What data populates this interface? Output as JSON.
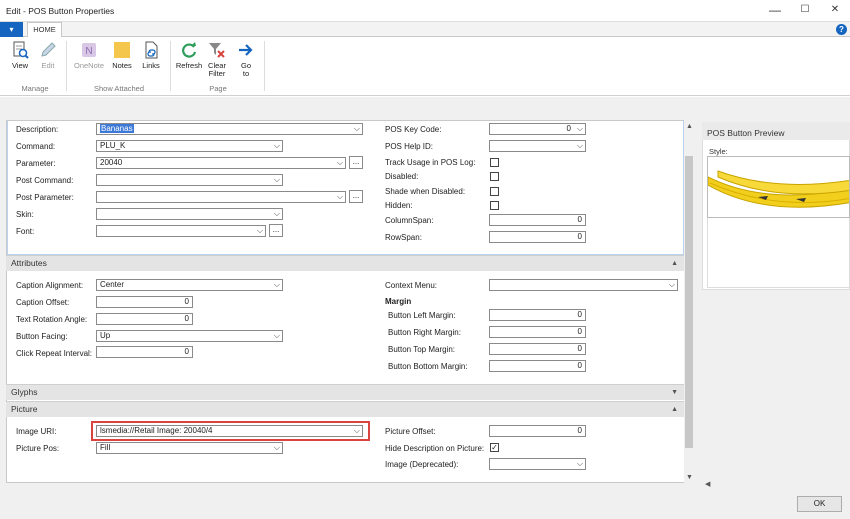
{
  "window": {
    "title": "Edit - POS Button Properties",
    "minimize": "—",
    "maximize": "☐",
    "close": "✕"
  },
  "ribbon": {
    "tab": "HOME",
    "app_menu": "▾",
    "help": "?",
    "buttons": {
      "view": "View",
      "edit": "Edit",
      "onenote": "OneNote",
      "notes": "Notes",
      "links": "Links",
      "refresh": "Refresh",
      "clear_filter_1": "Clear",
      "clear_filter_2": "Filter",
      "goto_1": "Go",
      "goto_2": "to"
    },
    "groups": {
      "manage": "Manage",
      "show_attached": "Show Attached",
      "page": "Page"
    }
  },
  "general": {
    "description_label": "Description:",
    "description_value": "Bananas",
    "command_label": "Command:",
    "command_value": "PLU_K",
    "parameter_label": "Parameter:",
    "parameter_value": "20040",
    "post_command_label": "Post Command:",
    "post_command_value": "",
    "post_parameter_label": "Post Parameter:",
    "post_parameter_value": "",
    "skin_label": "Skin:",
    "skin_value": "",
    "font_label": "Font:",
    "font_value": "",
    "pos_key_code_label": "POS Key Code:",
    "pos_key_code_value": "0",
    "pos_help_id_label": "POS Help ID:",
    "pos_help_id_value": "",
    "track_usage_label": "Track Usage in POS Log:",
    "disabled_label": "Disabled:",
    "shade_label": "Shade when Disabled:",
    "hidden_label": "Hidden:",
    "columnspan_label": "ColumnSpan:",
    "columnspan_value": "0",
    "rowspan_label": "RowSpan:",
    "rowspan_value": "0",
    "ellipsis": "..."
  },
  "attributes": {
    "header": "Attributes",
    "caption_alignment_label": "Caption Alignment:",
    "caption_alignment_value": "Center",
    "caption_offset_label": "Caption Offset:",
    "caption_offset_value": "0",
    "text_rotation_label": "Text Rotation Angle:",
    "text_rotation_value": "0",
    "button_facing_label": "Button Facing:",
    "button_facing_value": "Up",
    "click_repeat_label": "Click Repeat Interval:",
    "click_repeat_value": "0",
    "context_menu_label": "Context Menu:",
    "context_menu_value": "",
    "margin_header": "Margin",
    "left_margin_label": "Button Left Margin:",
    "left_margin_value": "0",
    "right_margin_label": "Button Right Margin:",
    "right_margin_value": "0",
    "top_margin_label": "Button Top Margin:",
    "top_margin_value": "0",
    "bottom_margin_label": "Button Bottom Margin:",
    "bottom_margin_value": "0"
  },
  "glyphs": {
    "header": "Glyphs"
  },
  "picture": {
    "header": "Picture",
    "image_uri_label": "Image URI:",
    "image_uri_value": "lsmedia://Retail Image: 20040/4",
    "picture_pos_label": "Picture Pos:",
    "picture_pos_value": "Fill",
    "picture_offset_label": "Picture Offset:",
    "picture_offset_value": "0",
    "hide_desc_label": "Hide Description on Picture:",
    "image_deprecated_label": "Image (Deprecated):",
    "image_deprecated_value": ""
  },
  "preview": {
    "title": "POS Button Preview",
    "style_label": "Style:"
  },
  "ok_button": "OK",
  "colors": {
    "accent": "#1565c0",
    "highlight": "#d9443e",
    "section": "#e4e4e4"
  }
}
